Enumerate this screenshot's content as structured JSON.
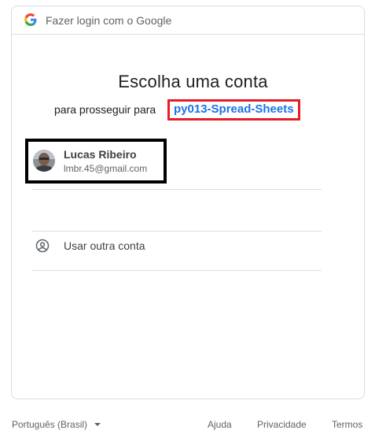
{
  "header": {
    "logo_icon": "google-g-icon",
    "text": "Fazer login com o Google"
  },
  "main": {
    "title": "Escolha uma conta",
    "subtitle_prefix": "para prosseguir para",
    "app_name": "py013-Spread-Sheets"
  },
  "accounts": [
    {
      "name": "Lucas Ribeiro",
      "email": "lmbr.45@gmail.com",
      "avatar_icon": "user-avatar-photo"
    }
  ],
  "other_account": {
    "icon": "person-circle-icon",
    "label": "Usar outra conta"
  },
  "footer": {
    "language": "Português (Brasil)",
    "help": "Ajuda",
    "privacy": "Privacidade",
    "terms": "Termos"
  },
  "colors": {
    "link_blue": "#1a73e8",
    "highlight_red": "#e41e26",
    "highlight_black": "#000000",
    "divider": "#dadce0"
  }
}
